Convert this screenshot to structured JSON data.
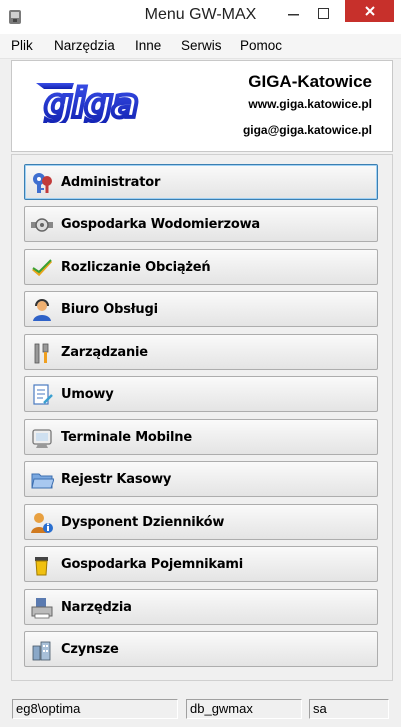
{
  "window": {
    "title": "Menu GW-MAX"
  },
  "menubar": [
    "Plik",
    "Narzędzia",
    "Inne",
    "Serwis",
    "Pomoc"
  ],
  "header": {
    "logo_text": "giga",
    "company_name": "GIGA-Katowice",
    "website": "www.giga.katowice.pl",
    "email": "giga@giga.katowice.pl"
  },
  "buttons": [
    {
      "label": "Administrator",
      "icon": "keys-icon"
    },
    {
      "label": "Gospodarka Wodomierzowa",
      "icon": "water-meter-icon"
    },
    {
      "label": "Rozliczanie Obciążeń",
      "icon": "checkmark-icon"
    },
    {
      "label": "Biuro Obsługi",
      "icon": "headset-user-icon"
    },
    {
      "label": "Zarządzanie",
      "icon": "tools-icon"
    },
    {
      "label": "Umowy",
      "icon": "document-icon"
    },
    {
      "label": "Terminale Mobilne",
      "icon": "mobile-terminal-icon"
    },
    {
      "label": "Rejestr Kasowy",
      "icon": "folder-icon"
    },
    {
      "label": "Dysponent Dzienników",
      "icon": "user-info-icon"
    },
    {
      "label": "Gospodarka Pojemnikami",
      "icon": "container-icon"
    },
    {
      "label": "Narzędzia",
      "icon": "printer-icon"
    },
    {
      "label": "Czynsze",
      "icon": "buildings-icon"
    }
  ],
  "statusbar": [
    "eg8\\optima",
    "db_gwmax",
    "sa"
  ],
  "colors": {
    "close_button": "#c7302b",
    "logo_blue": "#1a2fd0",
    "focus_border": "#3c7fb1"
  }
}
